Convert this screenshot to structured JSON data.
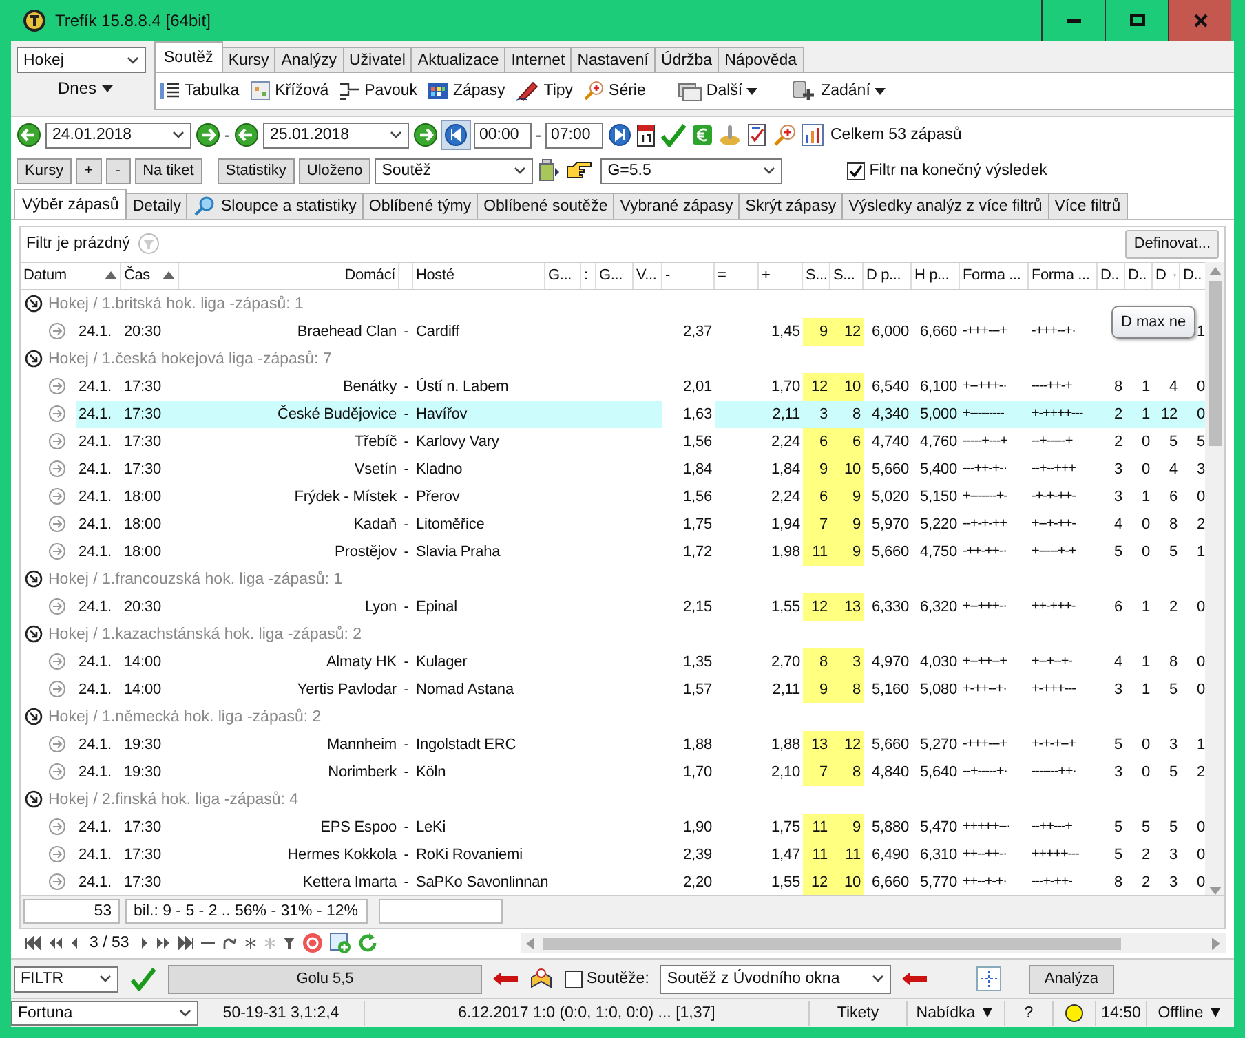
{
  "window": {
    "title": "Trefík 15.8.8.4 [64bit]"
  },
  "sport_select": {
    "value": "Hokej"
  },
  "day_menu": {
    "label": "Dnes"
  },
  "menu_tabs": [
    {
      "label": "Soutěž",
      "selected": true
    },
    {
      "label": "Kursy",
      "selected": false
    },
    {
      "label": "Analýzy",
      "selected": false
    },
    {
      "label": "Uživatel",
      "selected": false
    },
    {
      "label": "Aktualizace",
      "selected": false
    },
    {
      "label": "Internet",
      "selected": false
    },
    {
      "label": "Nastavení",
      "selected": false
    },
    {
      "label": "Údržba",
      "selected": false
    },
    {
      "label": "Nápověda",
      "selected": false
    }
  ],
  "ribbon": [
    {
      "label": "Tabulka",
      "kind": "list"
    },
    {
      "label": "Křížová",
      "kind": "grid"
    },
    {
      "label": "Pavouk",
      "kind": "bracket"
    },
    {
      "label": "Zápasy",
      "kind": "calendar"
    },
    {
      "label": "Tipy",
      "kind": "pencil"
    },
    {
      "label": "Série",
      "kind": "magnifier"
    },
    {
      "label": "Další",
      "kind": "folders",
      "dropdown": true
    },
    {
      "label": "Zadání",
      "kind": "database",
      "dropdown": true
    }
  ],
  "date_range": {
    "from": "24.01.2018",
    "dash": "-",
    "to": "25.01.2018",
    "time_from": "00:00",
    "time_dash": "-",
    "time_to": "07:00",
    "total": "Celkem 53 zápasů"
  },
  "action_buttons": [
    "Kursy",
    "+",
    "-",
    "Na tiket",
    "Statistiky",
    "Uloženo"
  ],
  "competition_select": {
    "value": "Soutěž"
  },
  "goals_select": {
    "value": "G=5.5"
  },
  "final_result_filter": {
    "label": "Filtr na konečný výsledek",
    "checked": true
  },
  "view_tabs": [
    {
      "label": "Výběr zápasů",
      "selected": true
    },
    {
      "label": "Detaily",
      "selected": false
    },
    {
      "label": "Sloupce a statistiky",
      "selected": false,
      "icon": true
    },
    {
      "label": "Oblíbené týmy",
      "selected": false
    },
    {
      "label": "Oblíbené soutěže",
      "selected": false
    },
    {
      "label": "Vybrané zápasy",
      "selected": false
    },
    {
      "label": "Skrýt zápasy",
      "selected": false
    },
    {
      "label": "Výsledky analýz z více filtrů",
      "selected": false
    },
    {
      "label": "Více filtrů",
      "selected": false
    }
  ],
  "filter": {
    "label": "Filtr je prázdný",
    "define_button": "Definovat..."
  },
  "table": {
    "columns": [
      {
        "label": "Datum",
        "sort_ascending": true
      },
      {
        "label": "Čas",
        "sort_ascending": true
      },
      {
        "label": "Domácí"
      },
      {
        "label": "Hosté"
      },
      {
        "label": "G..."
      },
      {
        "label": ":"
      },
      {
        "label": "G..."
      },
      {
        "label": "V..."
      },
      {
        "label": "-"
      },
      {
        "label": "="
      },
      {
        "label": "+"
      },
      {
        "label": "S..."
      },
      {
        "label": "S..."
      },
      {
        "label": "D p..."
      },
      {
        "label": "H p..."
      },
      {
        "label": "Forma ..."
      },
      {
        "label": "Forma ..."
      },
      {
        "label": "D.."
      },
      {
        "label": "D.."
      },
      {
        "label": "D",
        "filtered": true
      },
      {
        "label": "D.."
      }
    ],
    "groups": [
      {
        "title": "Hokej / 1.britská hok. liga -zápasů: 1",
        "rows": [
          {
            "date": "24.1.",
            "time": "20:30",
            "home": "Braehead Clan",
            "dash": "-",
            "away": "Cardiff",
            "minus": "2,37",
            "plus": "1,45",
            "s1": "9",
            "s2": "12",
            "dp": "6,000",
            "hp": "6,660",
            "form_home": "-+++---+",
            "form_away": "-+++--+·",
            "d4": "1",
            "selected": false
          }
        ]
      },
      {
        "title": "Hokej / 1.česká hokejová liga -zápasů: 7",
        "rows": [
          {
            "date": "24.1.",
            "time": "17:30",
            "home": "Benátky",
            "dash": "-",
            "away": "Ústí n. Labem",
            "minus": "2,01",
            "plus": "1,70",
            "s1": "12",
            "s2": "10",
            "dp": "6,540",
            "hp": "6,100",
            "form_home": "+--+++-·",
            "form_away": "----++-+",
            "d1": "8",
            "d2": "1",
            "d3": "4",
            "d4": "0",
            "selected": false
          },
          {
            "date": "24.1.",
            "time": "17:30",
            "home": "České Budějovice",
            "dash": "-",
            "away": "Havířov",
            "minus": "1,63",
            "plus": "2,11",
            "s1": "3",
            "s2": "8",
            "dp": "4,340",
            "hp": "5,000",
            "form_home": "+---------",
            "form_away": "+-++++---",
            "d1": "2",
            "d2": "1",
            "d3": "12",
            "d4": "0",
            "selected": true
          },
          {
            "date": "24.1.",
            "time": "17:30",
            "home": "Třebíč",
            "dash": "-",
            "away": "Karlovy Vary",
            "minus": "1,56",
            "plus": "2,24",
            "s1": "6",
            "s2": "6",
            "dp": "4,740",
            "hp": "4,760",
            "form_home": "-----+---+",
            "form_away": "--+-----+",
            "d1": "2",
            "d2": "0",
            "d3": "5",
            "d4": "5",
            "selected": false
          },
          {
            "date": "24.1.",
            "time": "17:30",
            "home": "Vsetín",
            "dash": "-",
            "away": "Kladno",
            "minus": "1,84",
            "plus": "1,84",
            "s1": "9",
            "s2": "10",
            "dp": "5,660",
            "hp": "5,400",
            "form_home": "---++-+-·",
            "form_away": "--+--+++",
            "d1": "3",
            "d2": "0",
            "d3": "4",
            "d4": "3",
            "selected": false
          },
          {
            "date": "24.1.",
            "time": "18:00",
            "home": "Frýdek - Místek",
            "dash": "-",
            "away": "Přerov",
            "minus": "1,56",
            "plus": "2,24",
            "s1": "6",
            "s2": "9",
            "dp": "5,020",
            "hp": "5,150",
            "form_home": "+-------+-",
            "form_away": "-+-+-++-",
            "d1": "3",
            "d2": "1",
            "d3": "6",
            "d4": "0",
            "selected": false
          },
          {
            "date": "24.1.",
            "time": "18:00",
            "home": "Kadaň",
            "dash": "-",
            "away": "Litoměřice",
            "minus": "1,75",
            "plus": "1,94",
            "s1": "7",
            "s2": "9",
            "dp": "5,970",
            "hp": "5,220",
            "form_home": "--+-+-++",
            "form_away": "+--+-++-",
            "d1": "4",
            "d2": "0",
            "d3": "8",
            "d4": "2",
            "selected": false
          },
          {
            "date": "24.1.",
            "time": "18:00",
            "home": "Prostějov",
            "dash": "-",
            "away": "Slavia Praha",
            "minus": "1,72",
            "plus": "1,98",
            "s1": "11",
            "s2": "9",
            "dp": "5,660",
            "hp": "4,750",
            "form_home": "-++-++-·",
            "form_away": "+-----+-+",
            "d1": "5",
            "d2": "0",
            "d3": "5",
            "d4": "1",
            "selected": false
          }
        ]
      },
      {
        "title": "Hokej / 1.francouzská hok. liga -zápasů: 1",
        "rows": [
          {
            "date": "24.1.",
            "time": "20:30",
            "home": "Lyon",
            "dash": "-",
            "away": "Epinal",
            "minus": "2,15",
            "plus": "1,55",
            "s1": "12",
            "s2": "13",
            "dp": "6,330",
            "hp": "6,320",
            "form_home": "+--+++-·",
            "form_away": "++-+++-",
            "d1": "6",
            "d2": "1",
            "d3": "2",
            "d4": "0",
            "selected": false
          }
        ]
      },
      {
        "title": "Hokej / 1.kazachstánská hok. liga -zápasů: 2",
        "rows": [
          {
            "date": "24.1.",
            "time": "14:00",
            "home": "Almaty HK",
            "dash": "-",
            "away": "Kulager",
            "minus": "1,35",
            "plus": "2,70",
            "s1": "8",
            "s2": "3",
            "dp": "4,970",
            "hp": "4,030",
            "form_home": "+--++--+",
            "form_away": "+--+--+-",
            "d1": "4",
            "d2": "1",
            "d3": "8",
            "d4": "0",
            "selected": false
          },
          {
            "date": "24.1.",
            "time": "14:00",
            "home": "Yertis Pavlodar",
            "dash": "-",
            "away": "Nomad Astana",
            "minus": "1,57",
            "plus": "2,11",
            "s1": "9",
            "s2": "8",
            "dp": "5,160",
            "hp": "5,080",
            "form_home": "+-++--+·",
            "form_away": "+-+++---",
            "d1": "3",
            "d2": "1",
            "d3": "5",
            "d4": "0",
            "selected": false
          }
        ]
      },
      {
        "title": "Hokej / 1.německá hok. liga -zápasů: 2",
        "rows": [
          {
            "date": "24.1.",
            "time": "19:30",
            "home": "Mannheim",
            "dash": "-",
            "away": "Ingolstadt ERC",
            "minus": "1,88",
            "plus": "1,88",
            "s1": "13",
            "s2": "12",
            "dp": "5,660",
            "hp": "5,270",
            "form_home": "-+++---+",
            "form_away": "+-+-+--+",
            "d1": "5",
            "d2": "0",
            "d3": "3",
            "d4": "1",
            "selected": false
          },
          {
            "date": "24.1.",
            "time": "19:30",
            "home": "Norimberk",
            "dash": "-",
            "away": "Köln",
            "minus": "1,70",
            "plus": "2,10",
            "s1": "7",
            "s2": "8",
            "dp": "4,840",
            "hp": "5,640",
            "form_home": "--+-----+·",
            "form_away": "-------++·",
            "d1": "3",
            "d2": "0",
            "d3": "5",
            "d4": "2",
            "selected": false
          }
        ]
      },
      {
        "title": "Hokej / 2.finská hok. liga -zápasů: 4",
        "rows": [
          {
            "date": "24.1.",
            "time": "17:30",
            "home": "EPS Espoo",
            "dash": "-",
            "away": "LeKi",
            "minus": "1,90",
            "plus": "1,75",
            "s1": "11",
            "s2": "9",
            "dp": "5,880",
            "hp": "5,470",
            "form_home": "+++++--·",
            "form_away": "--++---+",
            "d1": "5",
            "d2": "5",
            "d3": "5",
            "d4": "0",
            "selected": false
          },
          {
            "date": "24.1.",
            "time": "17:30",
            "home": "Hermes Kokkola",
            "dash": "-",
            "away": "RoKi Rovaniemi",
            "minus": "2,39",
            "plus": "1,47",
            "s1": "11",
            "s2": "11",
            "dp": "6,490",
            "hp": "6,310",
            "form_home": "++--++-·",
            "form_away": "+++++---",
            "d1": "5",
            "d2": "2",
            "d3": "3",
            "d4": "0",
            "selected": false
          },
          {
            "date": "24.1.",
            "time": "17:30",
            "home": "Kettera Imarta",
            "dash": "-",
            "away": "SaPKo Savonlinnan",
            "minus": "2,20",
            "plus": "1,55",
            "s1": "12",
            "s2": "10",
            "dp": "6,660",
            "hp": "5,770",
            "form_home": "++--+-+·",
            "form_away": "---+-++-",
            "d1": "8",
            "d2": "2",
            "d3": "3",
            "d4": "0",
            "selected": false
          }
        ]
      }
    ]
  },
  "tooltip": {
    "text": "D max ne"
  },
  "summary": {
    "count": "53",
    "balance": "bil.: 9 - 5 - 2 .. 56% - 31% - 12%"
  },
  "navigator": {
    "position": "3 / 53"
  },
  "filter_bar": {
    "filter_select": "FILTR",
    "goals_button": "Golu 5,5",
    "competitions_checkbox": {
      "label": "Soutěže:",
      "checked": false
    },
    "competition_source": "Soutěž z Úvodního okna",
    "analyze_button": "Analýza"
  },
  "status_bar": {
    "bookmaker": "Fortuna",
    "record": "50-19-31  3,1:2,4",
    "last_result": "6.12.2017 1:0 (0:0, 1:0, 0:0) ... [1,37]",
    "tickets": "Tikety",
    "offer": "Nabídka ▼",
    "help": "?",
    "time": "14:50",
    "connection": "Offline ▼"
  }
}
